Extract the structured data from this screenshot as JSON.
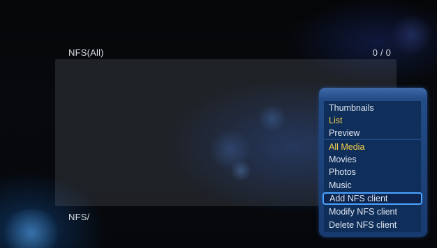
{
  "header": {
    "title": "NFS(All)",
    "count": "0 / 0"
  },
  "footer": {
    "path": "NFS/"
  },
  "menu": {
    "view_modes": [
      {
        "label": "Thumbnails",
        "state": "normal"
      },
      {
        "label": "List",
        "state": "selected"
      },
      {
        "label": "Preview",
        "state": "normal"
      }
    ],
    "filters": [
      {
        "label": "All Media",
        "state": "selected"
      },
      {
        "label": "Movies",
        "state": "normal"
      },
      {
        "label": "Photos",
        "state": "normal"
      },
      {
        "label": "Music",
        "state": "normal"
      }
    ],
    "actions": [
      {
        "label": "Add NFS client",
        "state": "focused"
      },
      {
        "label": "Modify NFS client",
        "state": "normal"
      },
      {
        "label": "Delete NFS client",
        "state": "normal"
      }
    ]
  },
  "colors": {
    "accent_selected": "#f6d24a",
    "focus_border": "#4aa3ff",
    "menu_background": "#173a6f",
    "text": "#dfe6f0"
  }
}
